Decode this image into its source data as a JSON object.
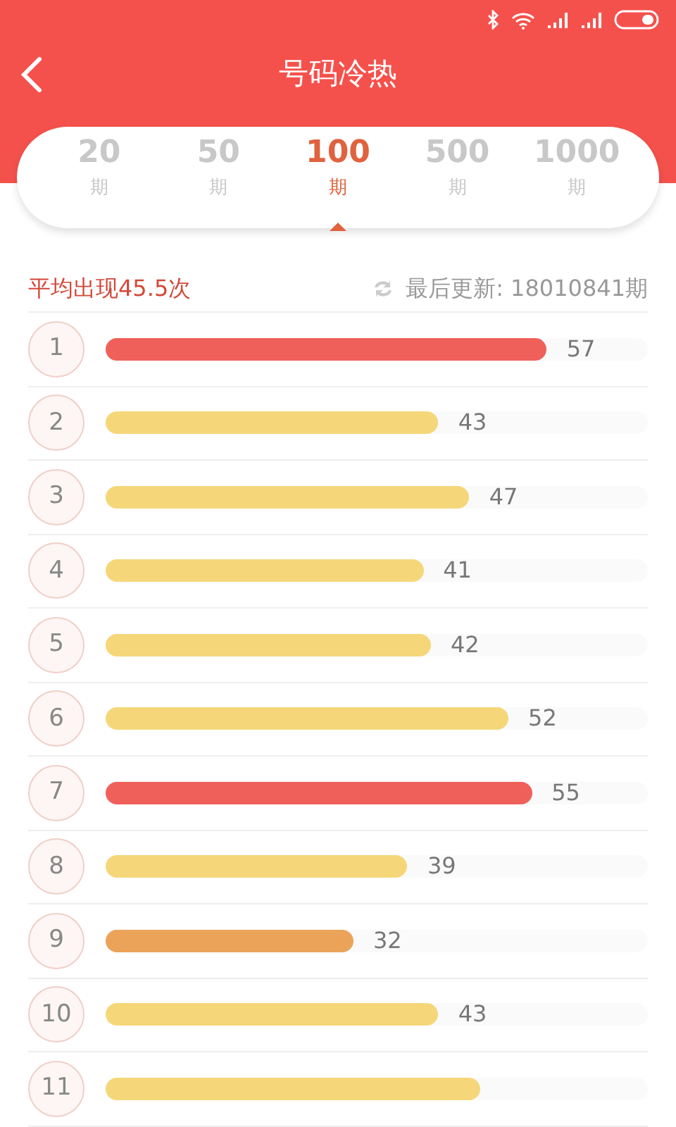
{
  "header": {
    "title": "号码冷热"
  },
  "periods": [
    {
      "number": "20",
      "unit": "期",
      "selected": false
    },
    {
      "number": "50",
      "unit": "期",
      "selected": false
    },
    {
      "number": "100",
      "unit": "期",
      "selected": true
    },
    {
      "number": "500",
      "unit": "期",
      "selected": false
    },
    {
      "number": "1000",
      "unit": "期",
      "selected": false
    }
  ],
  "summary": {
    "average": "平均出现45.5次",
    "last_update": "最后更新: 18010841期"
  },
  "rows": [
    {
      "number": "1",
      "level": 0.814,
      "value": "57",
      "color": "#f0605a"
    },
    {
      "number": "2",
      "level": 0.614,
      "value": "43",
      "color": "#f5d77a"
    },
    {
      "number": "3",
      "level": 0.671,
      "value": "47",
      "color": "#f5d77a"
    },
    {
      "number": "4",
      "level": 0.586,
      "value": "41",
      "color": "#f5d77a"
    },
    {
      "number": "5",
      "level": 0.6,
      "value": "42",
      "color": "#f5d77a"
    },
    {
      "number": "6",
      "level": 0.743,
      "value": "52",
      "color": "#f5d77a"
    },
    {
      "number": "7",
      "level": 0.786,
      "value": "55",
      "color": "#f0605a"
    },
    {
      "number": "8",
      "level": 0.557,
      "value": "39",
      "color": "#f5d77a"
    },
    {
      "number": "9",
      "level": 0.457,
      "value": "32",
      "color": "#eba35a"
    },
    {
      "number": "10",
      "level": 0.614,
      "value": "43",
      "color": "#f5d77a"
    },
    {
      "number": "11",
      "level": 0.69,
      "color": "#f5d77a"
    }
  ]
}
